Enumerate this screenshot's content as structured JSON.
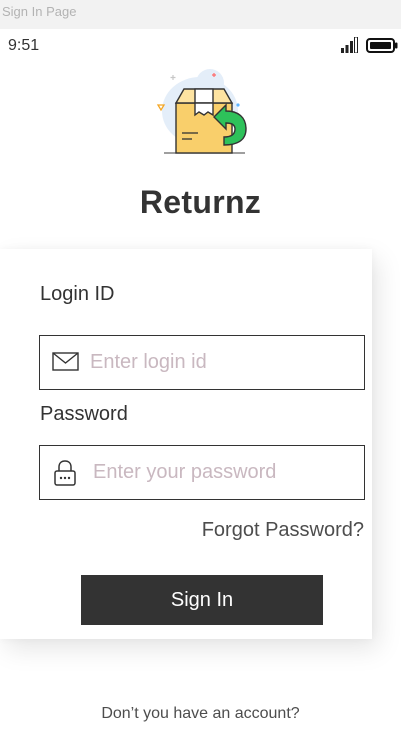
{
  "frame": {
    "title": "Sign In Page"
  },
  "status_bar": {
    "time": "9:51",
    "signal_icon": "cellular-signal-icon",
    "battery_icon": "battery-full-icon"
  },
  "app": {
    "name": "Returnz",
    "logo_icon": "return-package-icon"
  },
  "login_form": {
    "login_id": {
      "label": "Login ID",
      "placeholder": "Enter login id",
      "value": "",
      "icon": "envelope-icon"
    },
    "password": {
      "label": "Password",
      "placeholder": "Enter your password",
      "value": "",
      "icon": "lock-icon"
    },
    "forgot_password_label": "Forgot Password?",
    "sign_in_label": "Sign In"
  },
  "footer": {
    "account_prompt": "Don’t you have an account?"
  },
  "colors": {
    "primary": "#333333",
    "background": "#ffffff",
    "placeholder": "#c9b8c0",
    "box": "#f9cf6b",
    "arrow": "#2ec15a"
  }
}
